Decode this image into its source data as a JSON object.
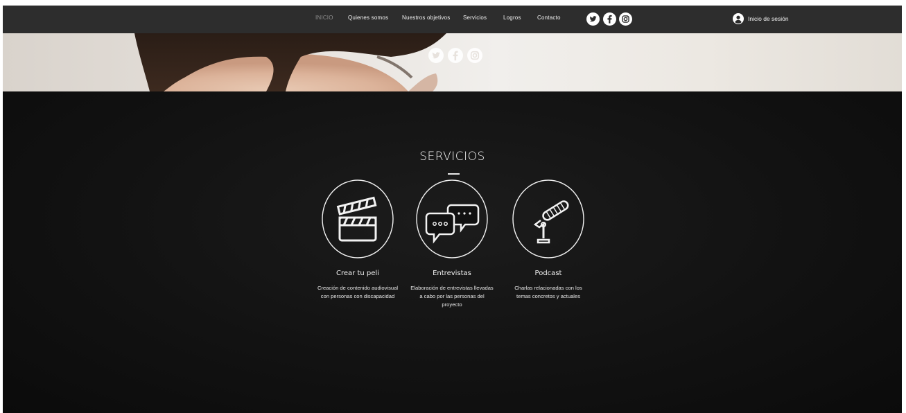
{
  "nav": {
    "items": [
      {
        "label": "INICIO",
        "active": true
      },
      {
        "label": "Quienes somos",
        "active": false
      },
      {
        "label": "Nuestros objetivos",
        "active": false
      },
      {
        "label": "Servicios",
        "active": false
      },
      {
        "label": "Logros",
        "active": false
      },
      {
        "label": "Contacto",
        "active": false
      }
    ],
    "social_icons": [
      "twitter-icon",
      "facebook-icon",
      "instagram-icon"
    ],
    "login_icon": "user-icon",
    "login_label": "Inicio de sesión"
  },
  "hero": {
    "social_icons": [
      "twitter-icon",
      "facebook-icon",
      "instagram-icon"
    ]
  },
  "services": {
    "title": "SERVICIOS",
    "cards": [
      {
        "icon": "clapperboard-icon",
        "title": "Crear tu peli",
        "description": "Creación de contenido audiovisual con personas con discapacidad"
      },
      {
        "icon": "chat-bubbles-icon",
        "title": "Entrevistas",
        "description": "Elaboración de entrevistas llevadas a cabo por las personas del proyecto"
      },
      {
        "icon": "microphone-icon",
        "title": "Podcast",
        "description": "Charlas relacionadas con los temas concretos y actuales"
      }
    ]
  },
  "colors": {
    "nav_bg": "#2d2d2d",
    "section_bg": "#121212",
    "text": "#f2f2f2",
    "nav_active": "#8f8f8f"
  }
}
